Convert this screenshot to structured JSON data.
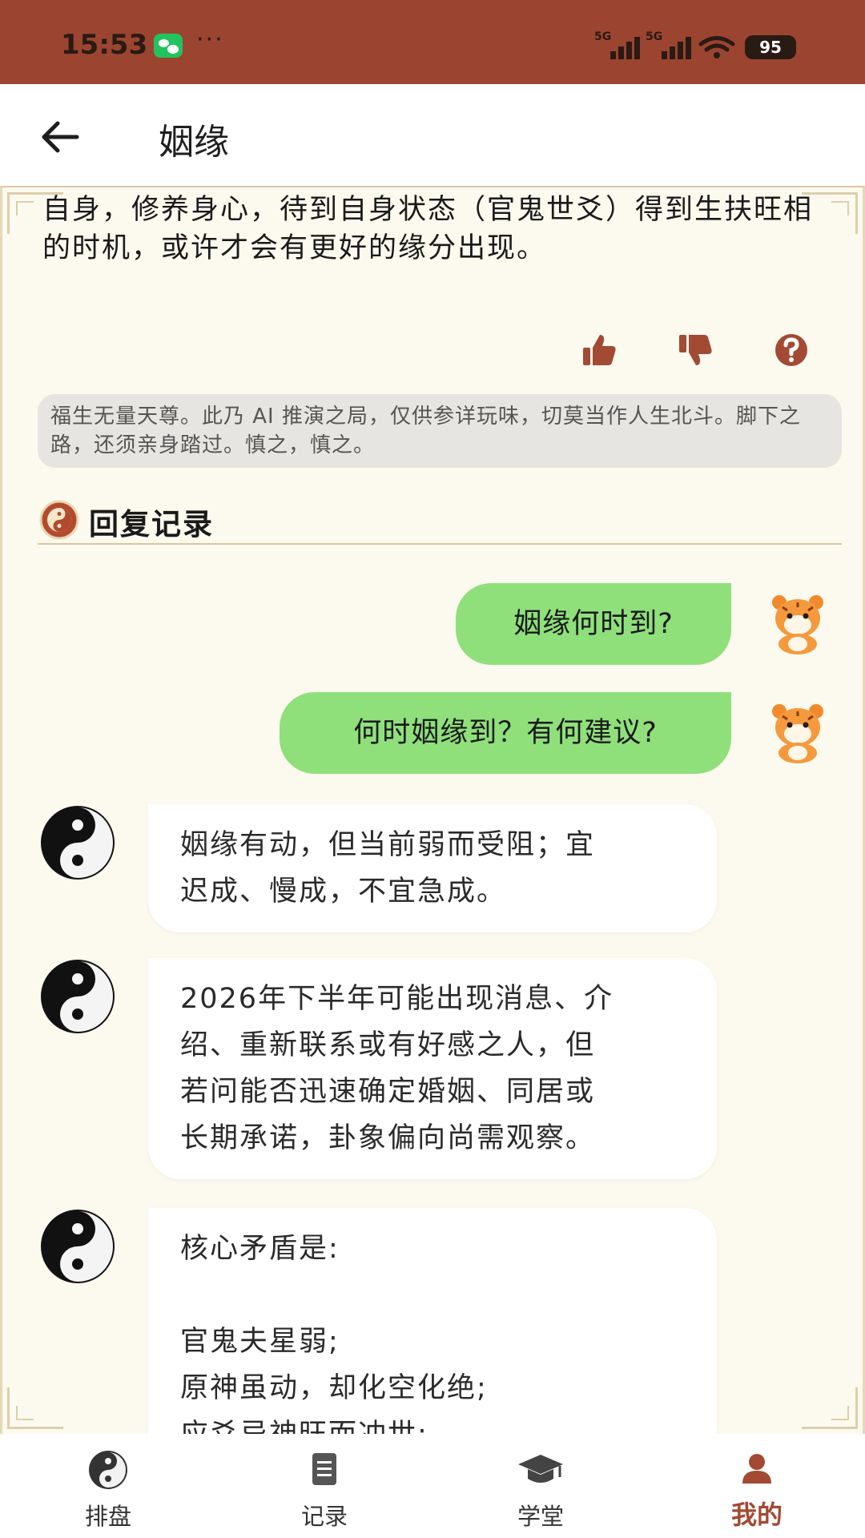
{
  "status_bar": {
    "time": "15:53",
    "more": "···",
    "signal1_label": "5G",
    "signal2_label": "5G",
    "battery": "95",
    "icons": [
      "wechat-icon",
      "signal-icon",
      "wifi-icon",
      "battery-icon"
    ]
  },
  "app_bar": {
    "title": "姻缘",
    "back_icon": "arrow-left-icon"
  },
  "answer": {
    "text": "自身，修养身心，待到自身状态（官鬼世爻）得到生扶旺相的时机，或许才会有更好的缘分出现。"
  },
  "feedback": {
    "icons": [
      "thumbs-up-icon",
      "thumbs-down-icon",
      "question-icon"
    ],
    "color": "#a24a33"
  },
  "disclaimer": "福生无量天尊。此乃 AI 推演之局，仅供参详玩味，切莫当作人生北斗。脚下之路，还须亲身踏过。慎之，慎之。",
  "history": {
    "title": "回复记录",
    "user_messages": [
      "姻缘何时到?",
      "何时姻缘到？有何建议?"
    ],
    "bot_messages": [
      [
        "姻缘有动，但当前弱而受阻；宜",
        "迟成、慢成，不宜急成。"
      ],
      [
        "2026年下半年可能出现消息、介",
        "绍、重新联系或有好感之人，但",
        "若问能否迅速确定婚姻、同居或",
        "长期承诺，卦象偏向尚需观察。"
      ],
      [
        "核心矛盾是:",
        "",
        "官鬼夫星弱;",
        "原神虽动，却化空化绝;",
        "应爻忌神旺而冲世;"
      ]
    ]
  },
  "bottom_nav": {
    "items": [
      {
        "label": "排盘",
        "icon": "yin-yang-icon"
      },
      {
        "label": "记录",
        "icon": "document-icon"
      },
      {
        "label": "学堂",
        "icon": "graduation-cap-icon"
      },
      {
        "label": "我的",
        "icon": "person-icon"
      }
    ],
    "active_index": 3,
    "active_color": "#a24a33"
  },
  "colors": {
    "status_bar": "#9b4430",
    "content_bg": "#fcf9ef",
    "user_bubble": "#8fe07b",
    "bot_bubble": "#ffffff",
    "accent": "#a24a33"
  }
}
